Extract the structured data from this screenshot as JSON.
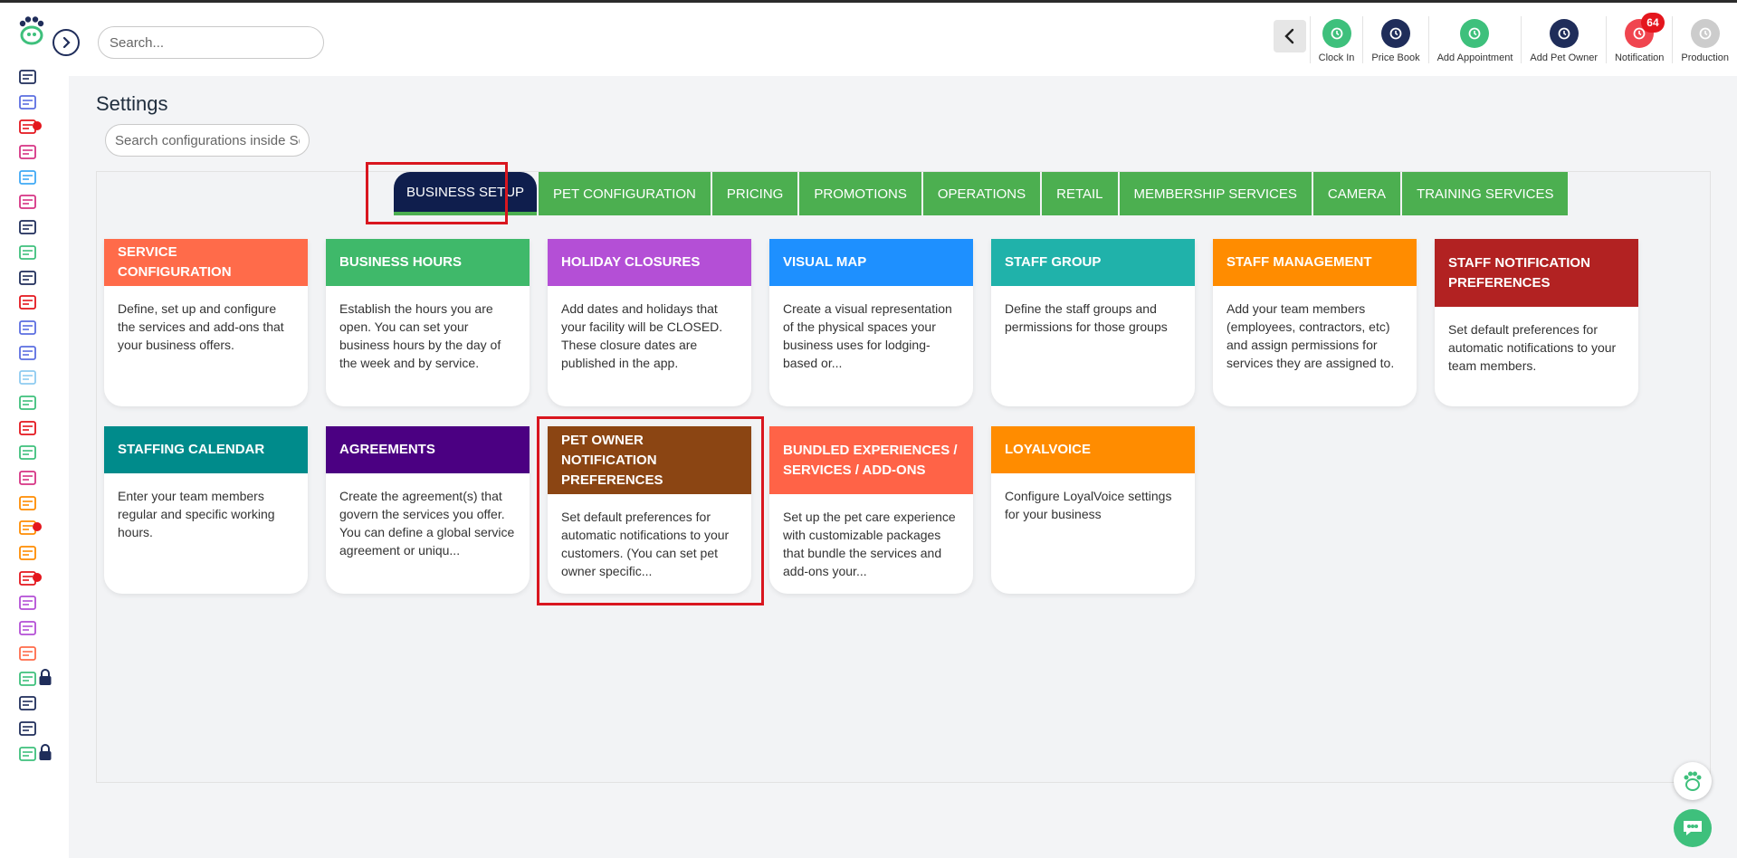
{
  "search": {
    "placeholder": "Search..."
  },
  "toolbar": {
    "items": [
      {
        "label": "Clock In",
        "icon": "clock-icon",
        "color": "#3ec07c"
      },
      {
        "label": "Price Book",
        "icon": "price-book-icon",
        "color": "#1f2d5a"
      },
      {
        "label": "Add Appointment",
        "icon": "add-appointment-icon",
        "color": "#3ec07c"
      },
      {
        "label": "Add Pet Owner",
        "icon": "add-pet-owner-icon",
        "color": "#1f2d5a"
      },
      {
        "label": "Notification",
        "icon": "bell-icon",
        "color": "#f0454f",
        "badge": "64"
      },
      {
        "label": "Production",
        "icon": "avatar-icon",
        "color": "#cccccc"
      }
    ]
  },
  "page": {
    "title": "Settings",
    "config_search_placeholder": "Search configurations inside Settings"
  },
  "tabs": [
    "BUSINESS SETUP",
    "PET CONFIGURATION",
    "PRICING",
    "PROMOTIONS",
    "OPERATIONS",
    "RETAIL",
    "MEMBERSHIP SERVICES",
    "CAMERA",
    "TRAINING SERVICES"
  ],
  "active_tab": "BUSINESS SETUP",
  "cards": [
    {
      "title": "SERVICE CONFIGURATION",
      "color": "#ff6b4a",
      "description": "Define, set up and configure the services and add-ons that your business offers."
    },
    {
      "title": "BUSINESS HOURS",
      "color": "#3fb96a",
      "description": "Establish the hours you are open. You can set your business hours by the day of the week and by service."
    },
    {
      "title": "HOLIDAY CLOSURES",
      "color": "#b44fd6",
      "description": "Add dates and holidays that your facility will be CLOSED. These closure dates are published in the app."
    },
    {
      "title": "VISUAL MAP",
      "color": "#1e90ff",
      "description": "Create a visual representation of the physical spaces your business uses for lodging-based or..."
    },
    {
      "title": "STAFF GROUP",
      "color": "#20b2aa",
      "description": "Define the staff groups and permissions for those groups"
    },
    {
      "title": "STAFF MANAGEMENT",
      "color": "#ff8c00",
      "description": "Add your team members (employees, contractors, etc) and assign permissions for services they are assigned to."
    },
    {
      "title": "STAFF NOTIFICATION PREFERENCES",
      "color": "#b22222",
      "description": "Set default preferences for automatic notifications to your team members."
    },
    {
      "title": "STAFFING CALENDAR",
      "color": "#008b8b",
      "description": "Enter your team members regular and specific working hours."
    },
    {
      "title": "AGREEMENTS",
      "color": "#4b0082",
      "description": "Create the agreement(s) that govern the services you offer. You can define a global service agreement or uniqu..."
    },
    {
      "title": "PET OWNER NOTIFICATION PREFERENCES",
      "color": "#8b4513",
      "description": "Set default preferences for automatic notifications to your customers. (You can set pet owner specific..."
    },
    {
      "title": "BUNDLED EXPERIENCES / SERVICES / ADD-ONS",
      "color": "#ff6347",
      "description": "Set up the pet care experience with customizable packages that bundle the services and add-ons your..."
    },
    {
      "title": "LOYALVOICE",
      "color": "#ff8c00",
      "description": "Configure LoyalVoice settings for your business"
    }
  ],
  "rail_icons": [
    "today-icon",
    "dashboard-icon",
    "calendar-alert-icon",
    "dog-walk-icon",
    "paw-icon",
    "store-icon",
    "list-icon",
    "pet-search-icon",
    "today-edit-icon",
    "calendar-edit-icon",
    "calendar-icon",
    "calendar-grid-icon",
    "layout-icon",
    "timer-icon",
    "report-icon",
    "grooming-cart-icon",
    "pet-location-icon",
    "paws-icon",
    "target-icon",
    "person-icon",
    "chat-icon",
    "image-icon",
    "thumbs-up-icon",
    "rocket-icon",
    "chart-lock-icon",
    "clock-search-icon",
    "team-icon",
    "tools-lock-icon"
  ]
}
